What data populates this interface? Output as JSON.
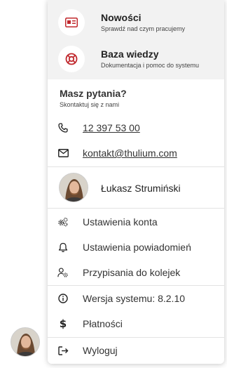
{
  "menu": {
    "news": {
      "title": "Nowości",
      "subtitle": "Sprawdź nad czym pracujemy",
      "icon": "news-card-icon"
    },
    "kb": {
      "title": "Baza wiedzy",
      "subtitle": "Dokumentacja i pomoc do systemu",
      "icon": "lifebuoy-icon"
    }
  },
  "contact": {
    "title": "Masz pytania?",
    "subtitle": "Skontaktuj się z nami",
    "phone": "12 397 53 00",
    "email": "kontakt@thulium.com"
  },
  "user": {
    "name": "Łukasz Strumiński"
  },
  "items": {
    "account": "Ustawienia konta",
    "notifications": "Ustawienia powiadomień",
    "queues": "Przypisania do kolejek",
    "version": "Wersja systemu: 8.2.10",
    "payments": "Płatności",
    "logout": "Wyloguj"
  },
  "colors": {
    "accent": "#c0282d",
    "panel_top": "#f2f2f2"
  }
}
